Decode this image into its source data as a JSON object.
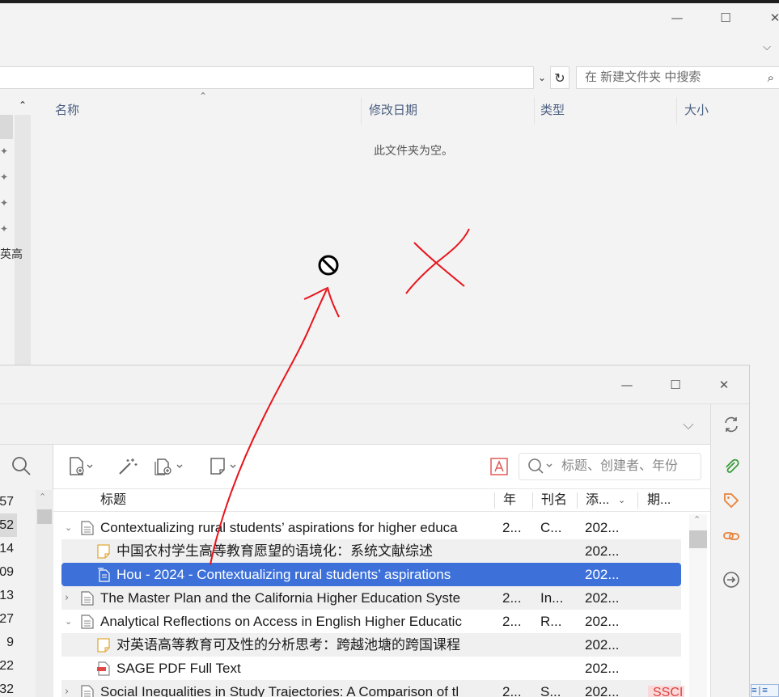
{
  "explorer": {
    "search_placeholder": "在 新建文件夹 中搜索",
    "address_text": "",
    "nav_partial_text": "英高",
    "columns": {
      "name": "名称",
      "date": "修改日期",
      "type": "类型",
      "size": "大小"
    },
    "empty_message": "此文件夹为空。",
    "window_buttons": {
      "minimize": "—",
      "maximize": "☐",
      "close": "✕"
    }
  },
  "zotero": {
    "window_buttons": {
      "minimize": "—",
      "maximize": "☐",
      "close": "✕"
    },
    "search_placeholder": "标题、创建者、年份",
    "collection_counts": [
      "57",
      "52",
      "14",
      "09",
      "13",
      "27",
      "9",
      "22",
      "32"
    ],
    "selected_count_index": 1,
    "columns": {
      "title": "标题",
      "year": "年",
      "publication": "刊名",
      "date_added": "添...",
      "extra": "期..."
    },
    "items": [
      {
        "kind": "parent",
        "expanded": true,
        "title": "Contextualizing rural students’ aspirations for higher educa",
        "year": "2...",
        "pub": "C...",
        "added": "202...",
        "extra": ""
      },
      {
        "kind": "note",
        "title": "中国农村学生高等教育愿望的语境化：系统文献综述",
        "year": "",
        "pub": "",
        "added": "202...",
        "extra": ""
      },
      {
        "kind": "attachment",
        "selected": true,
        "title": "Hou - 2024 - Contextualizing rural students’ aspirations",
        "year": "",
        "pub": "",
        "added": "202...",
        "extra": ""
      },
      {
        "kind": "parent",
        "expanded": false,
        "title": "The Master Plan and the California Higher Education Syste",
        "year": "2...",
        "pub": "In...",
        "added": "202...",
        "extra": ""
      },
      {
        "kind": "parent",
        "expanded": true,
        "title": "Analytical Reflections on Access in English Higher Educatic",
        "year": "2...",
        "pub": "R...",
        "added": "202...",
        "extra": ""
      },
      {
        "kind": "note",
        "title": "对英语高等教育可及性的分析思考：跨越池塘的跨国课程",
        "year": "",
        "pub": "",
        "added": "202...",
        "extra": ""
      },
      {
        "kind": "pdf",
        "title": "SAGE PDF Full Text",
        "year": "",
        "pub": "",
        "added": "202...",
        "extra": ""
      },
      {
        "kind": "parent",
        "expanded": false,
        "title": "Social Inequalities in Study Trajectories: A Comparison of tl",
        "year": "2...",
        "pub": "S...",
        "added": "202...",
        "extra": "SSCI"
      }
    ]
  },
  "colors": {
    "selection": "#3d71d9",
    "annotation_red": "#e8141c",
    "tag_orange": "#e8823a",
    "attach_green": "#3b9b3b"
  },
  "status_glyph": "≡|≡"
}
